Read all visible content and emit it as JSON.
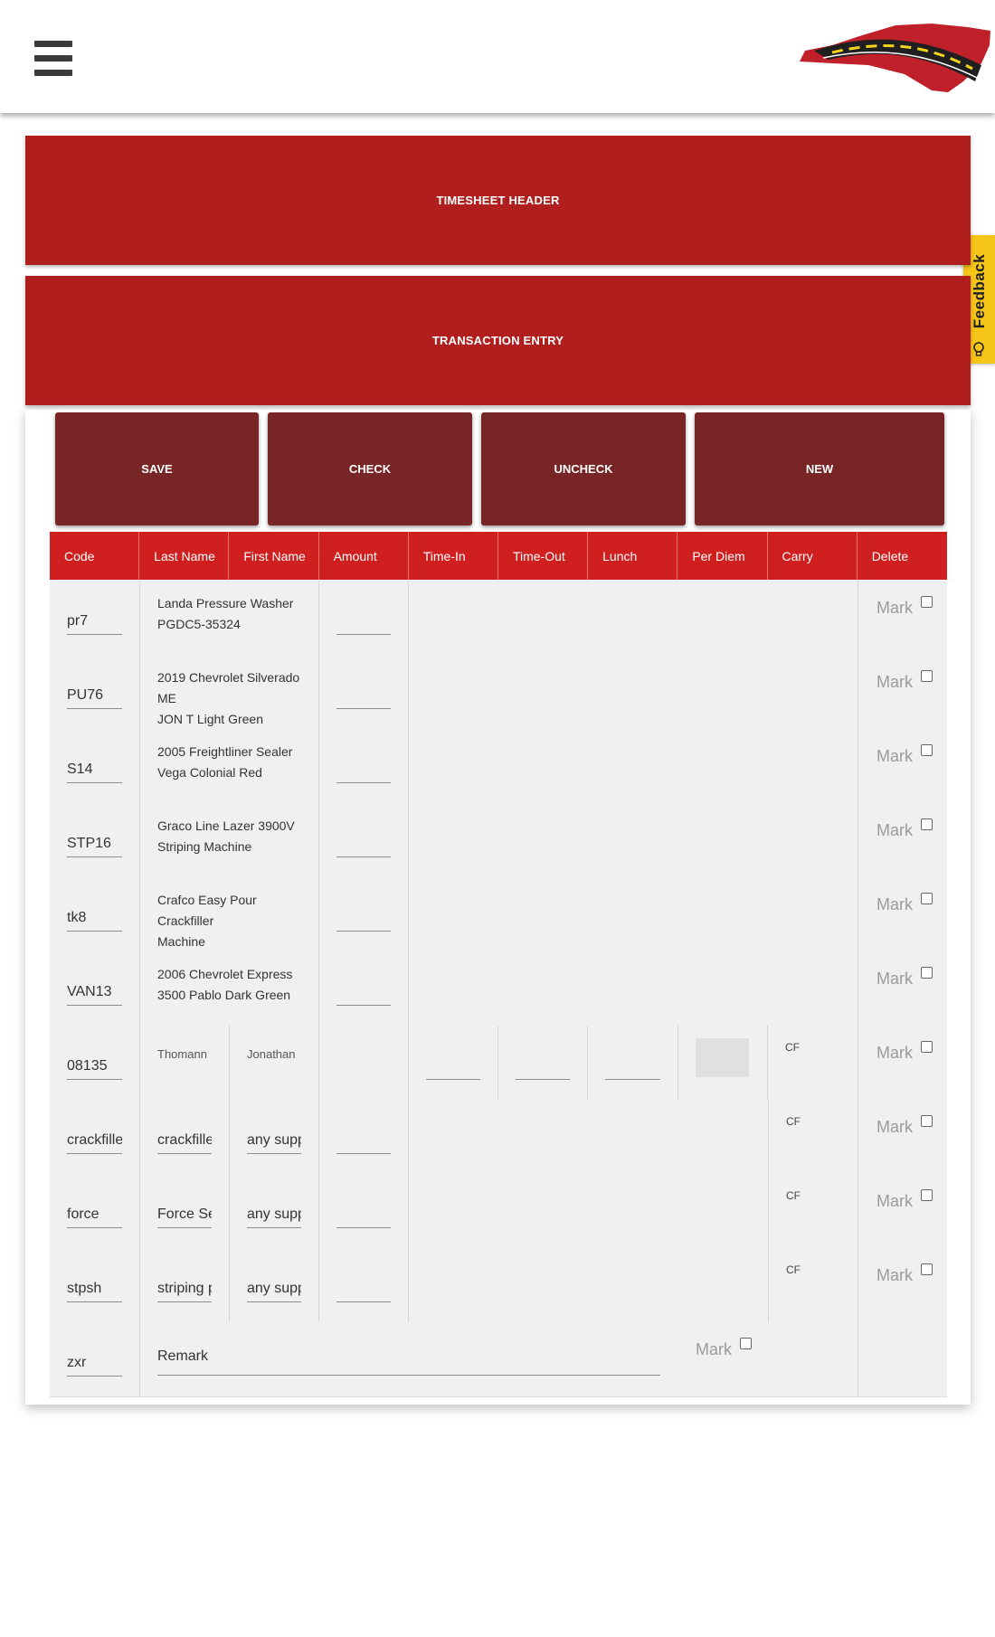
{
  "nav": {
    "menu_icon": "hamburger-menu-icon",
    "logo": "nc-road-logo"
  },
  "feedback": {
    "label": "Feedback",
    "icon": "lightbulb-icon"
  },
  "panels": {
    "timesheet_header": "TIMESHEET HEADER",
    "transaction_entry": "TRANSACTION ENTRY"
  },
  "actions": {
    "save": "SAVE",
    "check": "CHECK",
    "uncheck": "UNCHECK",
    "new": "NEW"
  },
  "columns": [
    "Code",
    "Last Name",
    "First Name",
    "Amount",
    "Time-In",
    "Time-Out",
    "Lunch",
    "Per Diem",
    "Carry",
    "Delete"
  ],
  "equipment_rows": [
    {
      "code": "pr7",
      "desc1": "Landa Pressure Washer",
      "desc2": "PGDC5-35324",
      "mark": "Mark"
    },
    {
      "code": "PU76",
      "desc1": "2019 Chevrolet Silverado ME",
      "desc2": "JON T Light Green",
      "mark": "Mark"
    },
    {
      "code": "S14",
      "desc1": "2005 Freightliner Sealer",
      "desc2": "Vega Colonial Red",
      "mark": "Mark"
    },
    {
      "code": "STP16",
      "desc1": "Graco Line Lazer 3900V",
      "desc2": "Striping Machine",
      "mark": "Mark"
    },
    {
      "code": "tk8",
      "desc1": "Crafco Easy Pour Crackfiller",
      "desc2": "Machine",
      "mark": "Mark"
    },
    {
      "code": "VAN13",
      "desc1": "2006 Chevrolet Express",
      "desc2": "3500 Pablo Dark Green",
      "mark": "Mark"
    }
  ],
  "employee_row": {
    "code": "08135",
    "last": "Thomann",
    "first": "Jonathan",
    "carry": "CF",
    "mark": "Mark"
  },
  "material_rows": [
    {
      "code": "crackfiller",
      "last": "crackfiller",
      "first": "any suppl",
      "carry": "CF",
      "mark": "Mark"
    },
    {
      "code": "force",
      "last": "Force Sea",
      "first": "any suppl",
      "carry": "CF",
      "mark": "Mark"
    },
    {
      "code": "stpsh",
      "last": "striping pa",
      "first": "any suppl",
      "carry": "CF",
      "mark": "Mark"
    }
  ],
  "remark_row": {
    "code": "zxr",
    "remark": "Remark",
    "mark": "Mark"
  },
  "colors": {
    "panel_red": "#b01e1e",
    "button_maroon": "#782525",
    "header_red": "#d01f1f",
    "feedback_yellow": "#f5c518"
  }
}
